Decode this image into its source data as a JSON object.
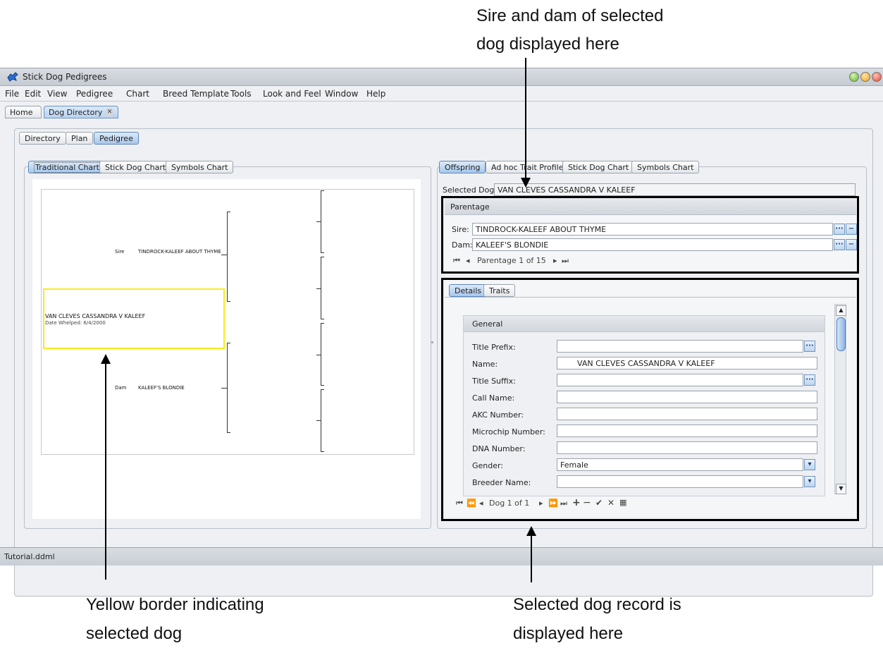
{
  "callouts": {
    "top_line1": "Sire and dam of selected",
    "top_line2": "dog displayed here",
    "bottom_left_line1": "Yellow border indicating",
    "bottom_left_line2": "selected dog",
    "bottom_right_line1": "Selected dog record is",
    "bottom_right_line2": "displayed here"
  },
  "window": {
    "title": "Stick Dog Pedigrees"
  },
  "menu": [
    "File",
    "Edit",
    "View",
    "Pedigree",
    "Chart",
    "Breed Template",
    "Tools",
    "Look and Feel",
    "Window",
    "Help"
  ],
  "doc_tabs": [
    "Home",
    "Dog Directory"
  ],
  "view_tabs": [
    "Directory",
    "Plan",
    "Pedigree"
  ],
  "chart_tabs": [
    "Traditional Chart",
    "Stick Dog Chart",
    "Symbols Chart"
  ],
  "right_tabs": [
    "Offspring",
    "Ad hoc Trait Profile",
    "Stick Dog Chart",
    "Symbols Chart"
  ],
  "pedigree": {
    "sire_label": "Sire",
    "sire_name": "TINDROCK-KALEEF ABOUT THYME",
    "dam_label": "Dam",
    "dam_name": "KALEEF'S BLONDIE",
    "selected_name": "VAN CLEVES CASSANDRA V KALEEF",
    "whelped": "Date Whelped: 6/4/2000"
  },
  "selected_dog": {
    "label": "Selected Dog:",
    "value": "VAN CLEVES CASSANDRA V KALEEF"
  },
  "parentage": {
    "header": "Parentage",
    "sire_label": "Sire:",
    "sire_value": "TINDROCK-KALEEF ABOUT THYME",
    "dam_label": "Dam:",
    "dam_value": "KALEEF'S BLONDIE",
    "nav_text": "Parentage 1 of 15"
  },
  "detail_tabs": [
    "Details",
    "Traits"
  ],
  "general": {
    "header": "General",
    "rows": [
      {
        "label": "Title Prefix:",
        "value": ""
      },
      {
        "label": "Name:",
        "value": "VAN CLEVES CASSANDRA V KALEEF"
      },
      {
        "label": "Title Suffix:",
        "value": ""
      },
      {
        "label": "Call Name:",
        "value": ""
      },
      {
        "label": "AKC Number:",
        "value": ""
      },
      {
        "label": "Microchip Number:",
        "value": ""
      },
      {
        "label": "DNA Number:",
        "value": ""
      },
      {
        "label": "Gender:",
        "value": "Female"
      },
      {
        "label": "Breeder Name:",
        "value": ""
      }
    ]
  },
  "record_nav": "Dog 1 of 1",
  "status": "Tutorial.ddml"
}
